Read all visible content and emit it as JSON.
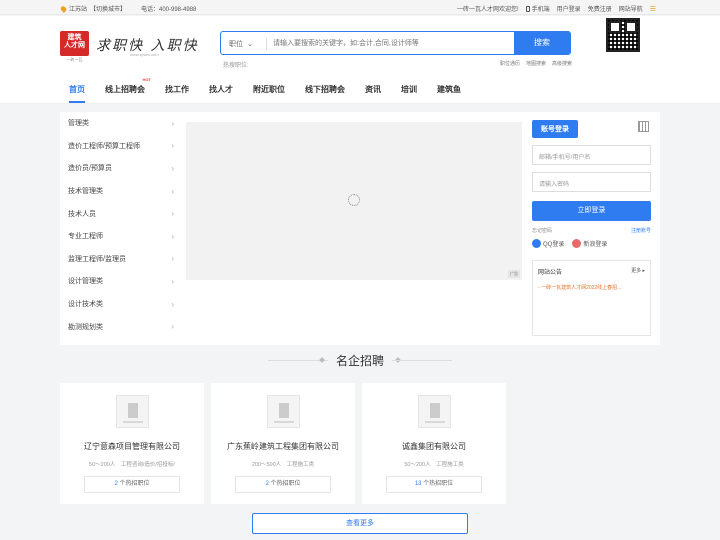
{
  "topbar": {
    "location": "江苏站",
    "switch_city": "【切换城市】",
    "phone": "电话：400-998-4988",
    "welcome": "一砖一瓦人才网欢迎您!",
    "mobile": "手机端",
    "user_login": "用户登录",
    "free_register": "免费注册",
    "site_nav": "网站导航",
    "menu_glyph": "☰"
  },
  "header": {
    "logo_line1": "建筑",
    "logo_line2": "人才网",
    "logo_sub": "一砖一瓦",
    "slogan": "求职快 入职快",
    "slogan_url": "www.zpwm.com",
    "search_select": "职位",
    "search_placeholder": "请输入要搜索的关键字，如:会计,合同,设计师等",
    "search_button": "搜索",
    "hot_label": "热搜职位:",
    "links": [
      "职位通历",
      "地图搜索",
      "高级搜索"
    ]
  },
  "nav": {
    "items": [
      "首页",
      "线上招聘会",
      "找工作",
      "找人才",
      "附近职位",
      "线下招聘会",
      "资讯",
      "培训",
      "建筑鱼"
    ],
    "hot_badge": "HOT"
  },
  "categories": [
    "管理类",
    "造价工程师/预算工程师",
    "造价员/预算员",
    "技术管理类",
    "技术人员",
    "专业工程师",
    "监理工程师/监理员",
    "设计管理类",
    "设计技术类",
    "勘测规划类"
  ],
  "banner": {
    "ad_tag": "广告"
  },
  "login": {
    "tab": "账号登录",
    "username_placeholder": "邮箱/手机号/用户名",
    "password_placeholder": "请输入密码",
    "button": "立即登录",
    "forgot": "忘记密码",
    "register": "注册账号",
    "qq": "QQ登录",
    "weibo": "新浪登录"
  },
  "notice": {
    "title": "网站公告",
    "more": "更多 ▸",
    "items": [
      "一砖一瓦建筑人才网2022线上春招..."
    ]
  },
  "section": {
    "title": "名企招聘"
  },
  "companies": [
    {
      "name": "辽宁意森项目管理有限公司",
      "meta": "50～200人　工程咨询/造价/招投标/",
      "jobs_count": "2",
      "jobs_suffix": "个热招职位"
    },
    {
      "name": "广东蕉岭建筑工程集团有限公司",
      "meta": "200～500人　工程施工类",
      "jobs_count": "2",
      "jobs_suffix": "个热招职位"
    },
    {
      "name": "诚鑫集团有限公司",
      "meta": "50～200人　工程施工类",
      "jobs_count": "13",
      "jobs_suffix": "个热招职位"
    }
  ],
  "more_button": "查看更多",
  "colors": {
    "accent": "#2f7cf0",
    "brand_red": "#d62a2a",
    "notice_orange": "#e8722b"
  }
}
